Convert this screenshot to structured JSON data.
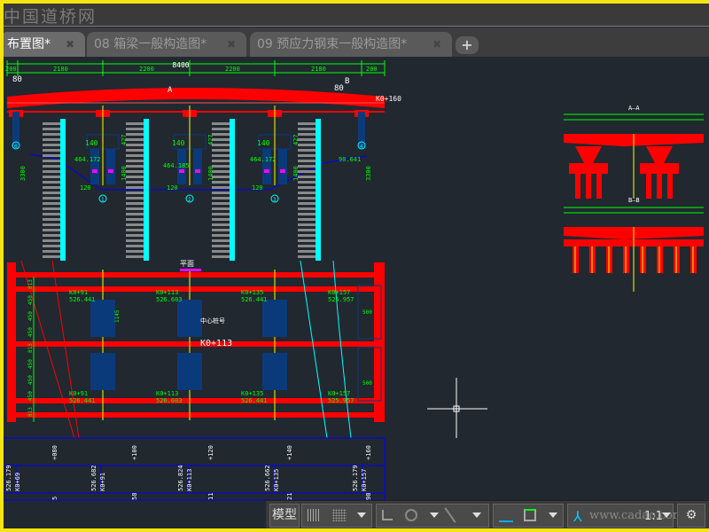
{
  "watermark": "中国道桥网",
  "tabs": [
    {
      "label": "布置图*",
      "active": true
    },
    {
      "label": "08 箱梁一般构造图*",
      "active": false
    },
    {
      "label": "09 预应力钢束一般构造图*",
      "active": false
    }
  ],
  "add_tab": "+",
  "close_glyph": "✖",
  "drawing": {
    "overall_dim": "8400",
    "span_dims": [
      "200",
      "2180",
      "2200",
      "2200",
      "2180",
      "200"
    ],
    "support_left": "80",
    "support_right": "80",
    "section_A": "A",
    "section_B": "B",
    "chainage_right": "K0+160",
    "pier_labels": [
      "0",
      "1",
      "2",
      "3",
      "4"
    ],
    "dim_140": "140",
    "dim_120": "120",
    "dim_427": "427",
    "dim_3300": "3300",
    "dim_1400": "1400",
    "elev_labels": [
      "464.172",
      "464.185",
      "464.172",
      "90.641"
    ],
    "plan_title": "平面",
    "plan_points_top": [
      {
        "k": "K0+91",
        "e": "526.441"
      },
      {
        "k": "K0+113",
        "e": "526.603"
      },
      {
        "k": "K0+135",
        "e": "526.441"
      },
      {
        "k": "K0+157",
        "e": "525.957"
      }
    ],
    "plan_points_bottom": [
      {
        "k": "K0+91",
        "e": "526.441"
      },
      {
        "k": "K0+113",
        "e": "526.603"
      },
      {
        "k": "K0+135",
        "e": "526.441"
      },
      {
        "k": "K0+157",
        "e": "525.957"
      }
    ],
    "center_label": "中心桩号",
    "center_k": "K0+113",
    "dim_500": "500",
    "dim_450": "450",
    "dim_813": "813",
    "dim_1145": "1145",
    "table_row1": [
      "+080",
      "+100",
      "+120",
      "+140",
      "+160"
    ],
    "table_row2": [
      {
        "e": "526.179",
        "k": "K0+69"
      },
      {
        "e": "526.682",
        "k": "K0+91"
      },
      {
        "e": "526.824",
        "k": "K0+113"
      },
      {
        "e": "526.662",
        "k": "K0+135"
      },
      {
        "e": "526.179",
        "k": "K0+157"
      }
    ],
    "table_row3": [
      "5",
      "58",
      "11",
      "21",
      "98"
    ],
    "sec_AA": "A—A",
    "sec_BB": "B—B"
  },
  "status": {
    "model": "模型",
    "scale": "1:1",
    "watermark_url": "www.cadao.com"
  },
  "colors": {
    "bg": "#212830",
    "red": "#ff0000",
    "green": "#00ff00",
    "cyan": "#00ffff",
    "blue": "#0000ff",
    "magenta": "#ff00ff",
    "yellow": "#ffff00",
    "navy": "#0b3a7a"
  }
}
